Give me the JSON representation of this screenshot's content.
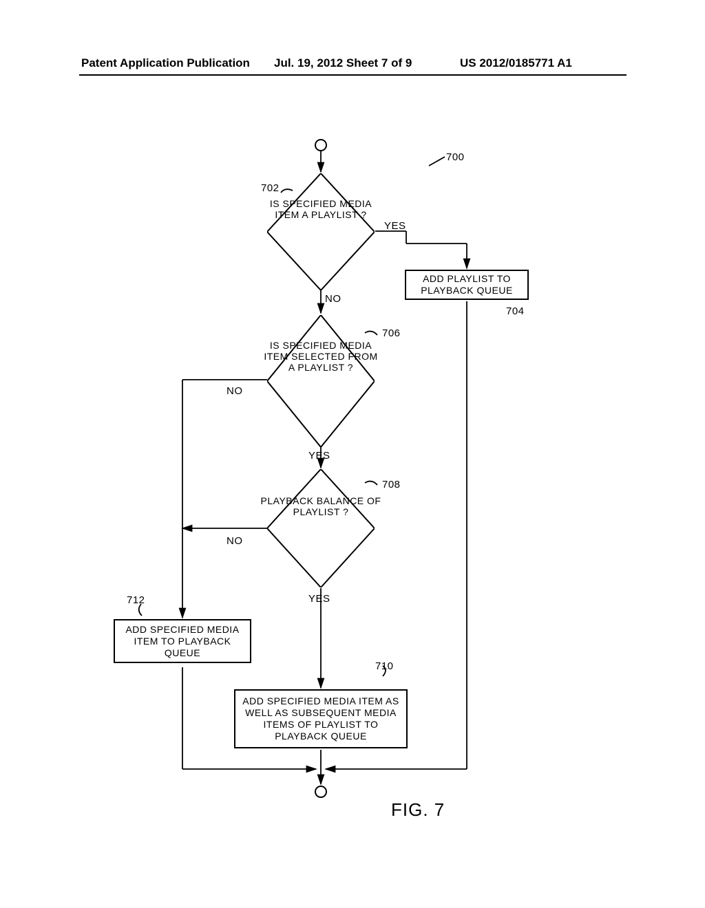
{
  "header": {
    "left": "Patent Application Publication",
    "center": "Jul. 19, 2012  Sheet 7 of 9",
    "right": "US 2012/0185771 A1"
  },
  "labels": {
    "ref700": "700",
    "ref702": "702",
    "ref704": "704",
    "ref706": "706",
    "ref708": "708",
    "ref710": "710",
    "ref712": "712",
    "yes1": "YES",
    "no1": "NO",
    "yes2": "YES",
    "no2": "NO",
    "yes3": "YES",
    "no3": "NO"
  },
  "nodes": {
    "d702": "IS SPECIFIED MEDIA ITEM A PLAYLIST ?",
    "d706": "IS SPECIFIED MEDIA ITEM SELECTED FROM A PLAYLIST ?",
    "d708": "PLAYBACK BALANCE OF PLAYLIST ?",
    "r704": "ADD PLAYLIST TO PLAYBACK QUEUE",
    "r710": "ADD SPECIFIED MEDIA ITEM AS WELL AS SUBSEQUENT MEDIA ITEMS OF PLAYLIST TO PLAYBACK QUEUE",
    "r712": "ADD SPECIFIED MEDIA ITEM TO PLAYBACK QUEUE"
  },
  "figure": "FIG. 7",
  "chart_data": {
    "type": "flowchart",
    "title": "FIG. 7",
    "reference": "700",
    "nodes": [
      {
        "id": "start",
        "type": "terminator",
        "label": ""
      },
      {
        "id": "702",
        "type": "decision",
        "label": "IS SPECIFIED MEDIA ITEM A PLAYLIST ?"
      },
      {
        "id": "704",
        "type": "process",
        "label": "ADD PLAYLIST TO PLAYBACK QUEUE"
      },
      {
        "id": "706",
        "type": "decision",
        "label": "IS SPECIFIED MEDIA ITEM SELECTED FROM A PLAYLIST ?"
      },
      {
        "id": "708",
        "type": "decision",
        "label": "PLAYBACK BALANCE OF PLAYLIST ?"
      },
      {
        "id": "710",
        "type": "process",
        "label": "ADD SPECIFIED MEDIA ITEM AS WELL AS SUBSEQUENT MEDIA ITEMS OF PLAYLIST TO PLAYBACK QUEUE"
      },
      {
        "id": "712",
        "type": "process",
        "label": "ADD SPECIFIED MEDIA ITEM TO PLAYBACK QUEUE"
      },
      {
        "id": "end",
        "type": "terminator",
        "label": ""
      }
    ],
    "edges": [
      {
        "from": "start",
        "to": "702"
      },
      {
        "from": "702",
        "to": "704",
        "label": "YES"
      },
      {
        "from": "702",
        "to": "706",
        "label": "NO"
      },
      {
        "from": "706",
        "to": "712",
        "label": "NO"
      },
      {
        "from": "706",
        "to": "708",
        "label": "YES"
      },
      {
        "from": "708",
        "to": "712",
        "label": "NO"
      },
      {
        "from": "708",
        "to": "710",
        "label": "YES"
      },
      {
        "from": "704",
        "to": "end"
      },
      {
        "from": "710",
        "to": "end"
      },
      {
        "from": "712",
        "to": "end"
      }
    ]
  }
}
